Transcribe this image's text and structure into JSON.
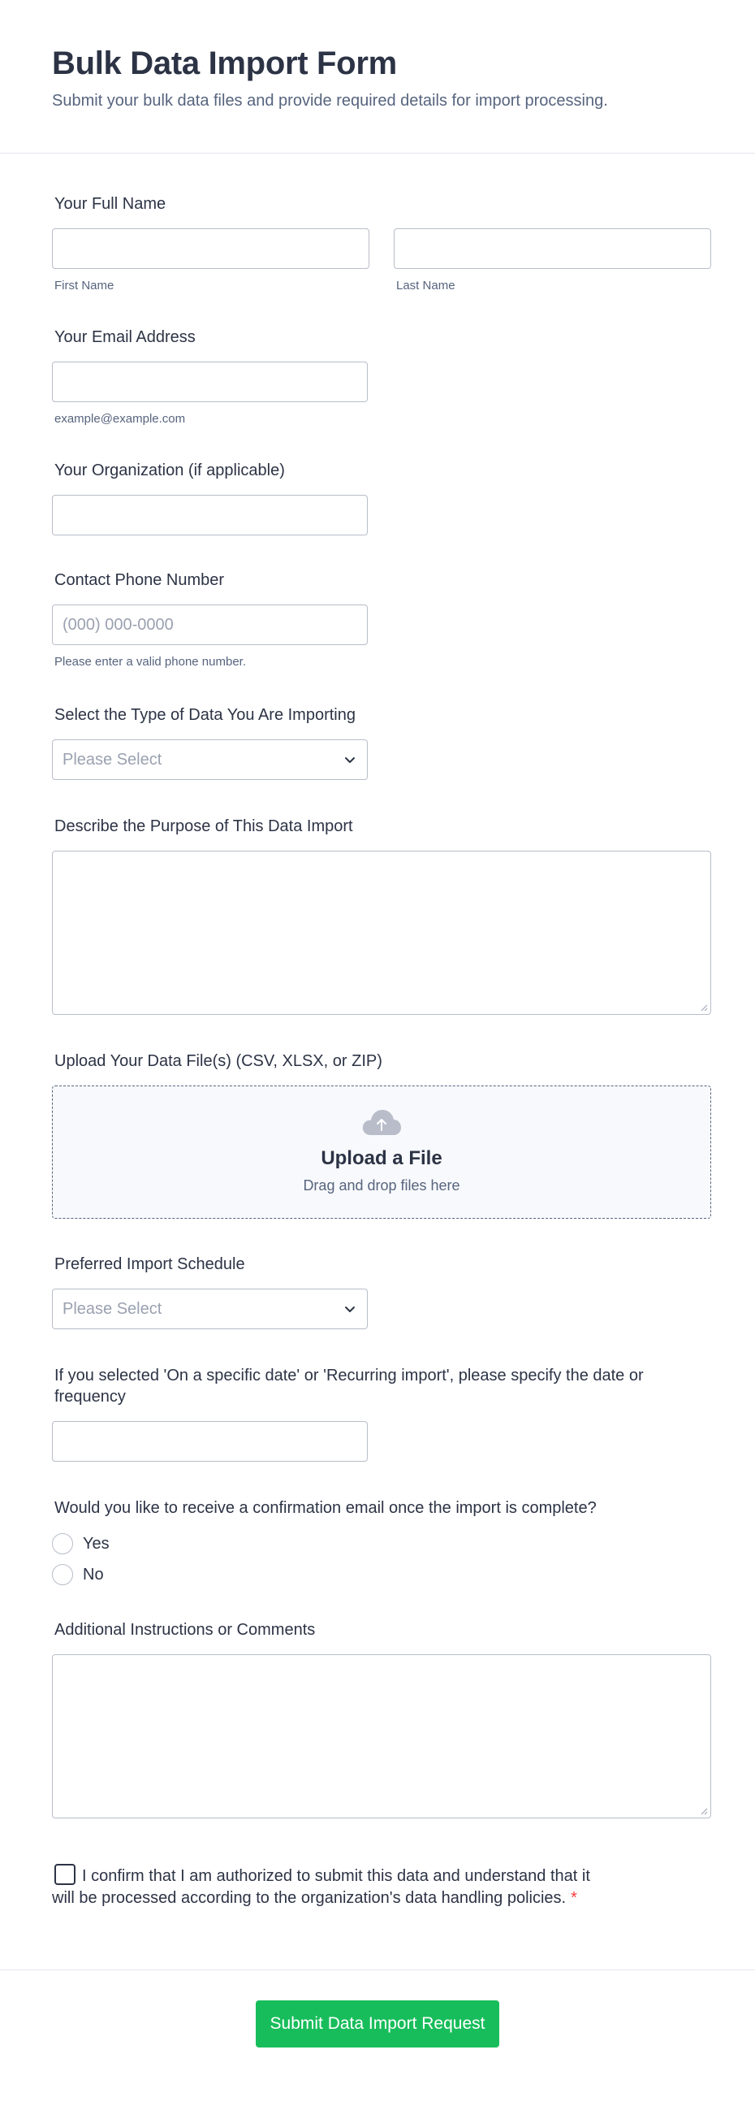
{
  "header": {
    "title": "Bulk Data Import Form",
    "subtitle": "Submit your bulk data files and provide required details for import processing."
  },
  "full_name": {
    "label": "Your Full Name",
    "first_sublabel": "First Name",
    "last_sublabel": "Last Name",
    "first_value": "",
    "last_value": ""
  },
  "email": {
    "label": "Your Email Address",
    "sublabel": "example@example.com",
    "value": ""
  },
  "organization": {
    "label": "Your Organization (if applicable)",
    "value": ""
  },
  "phone": {
    "label": "Contact Phone Number",
    "placeholder": "(000) 000-0000",
    "sublabel": "Please enter a valid phone number."
  },
  "data_type": {
    "label": "Select the Type of Data You Are Importing",
    "selected": "Please Select"
  },
  "purpose": {
    "label": "Describe the Purpose of This Data Import"
  },
  "upload": {
    "label": "Upload Your Data File(s) (CSV, XLSX, or ZIP)",
    "title": "Upload a File",
    "subtitle": "Drag and drop files here",
    "icon": "cloud-upload-icon"
  },
  "schedule": {
    "label": "Preferred Import Schedule",
    "selected": "Please Select"
  },
  "specify": {
    "label_line1": "If you selected 'On a specific date' or 'Recurring import', please specify the date or",
    "label_line2": "frequency",
    "value": ""
  },
  "confirmation_email": {
    "label": "Would you like to receive a confirmation email once the import is complete?",
    "options": [
      "Yes",
      "No"
    ]
  },
  "comments": {
    "label": "Additional Instructions or Comments"
  },
  "consent": {
    "line1": "I confirm that I am authorized to submit this data and understand that it",
    "line2": "will be processed according to the organization's data handling policies.",
    "required_mark": "*"
  },
  "submit": {
    "label": "Submit Data Import Request"
  },
  "colors": {
    "accent": "#18bd5b",
    "text": "#2c3345",
    "muted": "#57647e",
    "border": "#b8bdc9",
    "required": "#f23a3c"
  }
}
